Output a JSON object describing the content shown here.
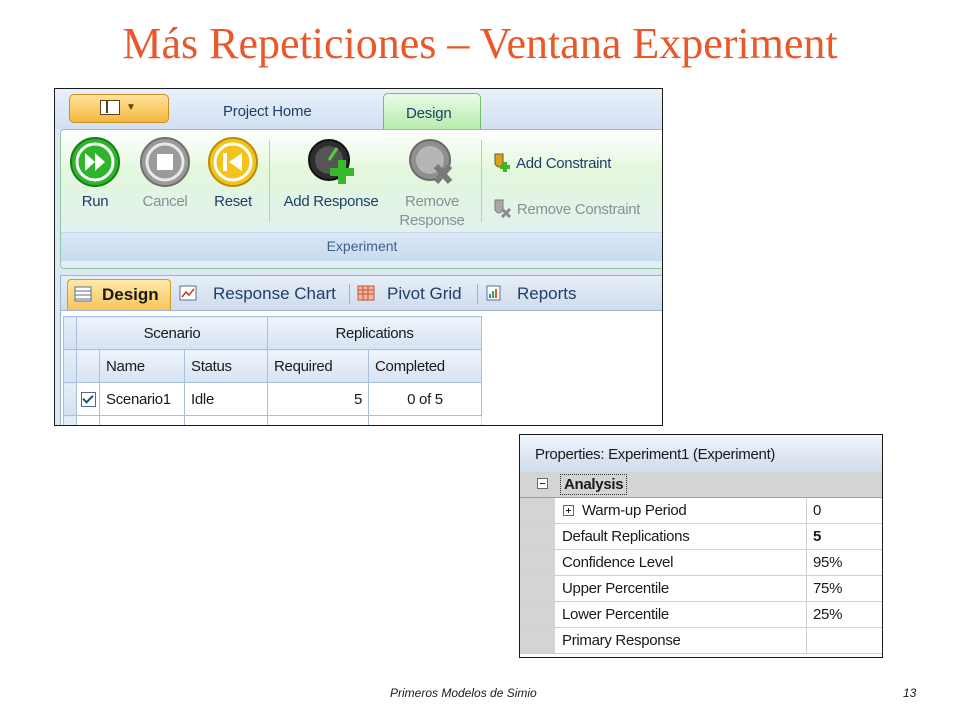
{
  "slide": {
    "title": "Más Repeticiones – Ventana Experiment",
    "footer_text": "Primeros Modelos de Simio",
    "page_number": "13"
  },
  "ribbon": {
    "tabs": [
      "Project Home",
      "Design"
    ],
    "active_tab": "Design",
    "buttons": {
      "run": "Run",
      "cancel": "Cancel",
      "reset": "Reset",
      "add_response": "Add Response",
      "remove_response_1": "Remove",
      "remove_response_2": "Response",
      "add_constraint": "Add Constraint",
      "remove_constraint": "Remove Constraint"
    },
    "group_label": "Experiment"
  },
  "panel": {
    "tabs": [
      "Design",
      "Response Chart",
      "Pivot Grid",
      "Reports"
    ],
    "active_tab": "Design"
  },
  "grid": {
    "group_headers": [
      "Scenario",
      "Replications"
    ],
    "columns": [
      "Name",
      "Status",
      "Required",
      "Completed"
    ],
    "rows": [
      {
        "checked": true,
        "name": "Scenario1",
        "status": "Idle",
        "required": "5",
        "completed": "0 of 5"
      }
    ]
  },
  "properties": {
    "title": "Properties: Experiment1 (Experiment)",
    "category": "Analysis",
    "rows": [
      {
        "name": "Warm-up Period",
        "value": "0",
        "expandable": true
      },
      {
        "name": "Default Replications",
        "value": "5",
        "bold": true
      },
      {
        "name": "Confidence Level",
        "value": "95%"
      },
      {
        "name": "Upper Percentile",
        "value": "75%"
      },
      {
        "name": "Lower Percentile",
        "value": "25%"
      },
      {
        "name": "Primary Response",
        "value": ""
      }
    ]
  },
  "colors": {
    "title": "#e8582a",
    "run_icon": "#2db52b",
    "reset_icon": "#f2c419",
    "ribbon_active_tab": "#b7eba9",
    "panel_active_tab": "#f7c55a"
  }
}
